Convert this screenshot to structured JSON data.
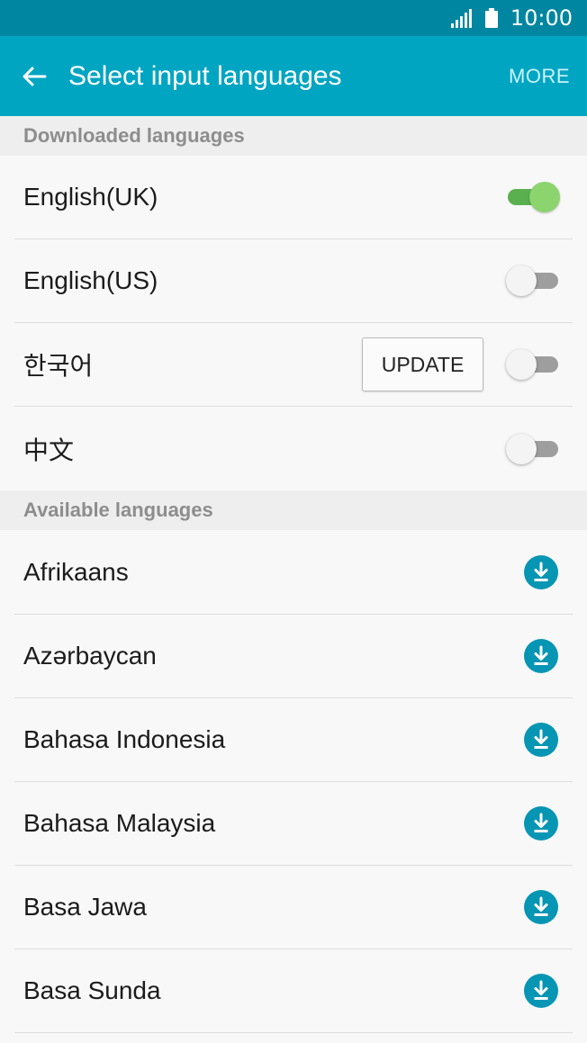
{
  "status_bar": {
    "time": "10:00"
  },
  "app_bar": {
    "title": "Select input languages",
    "more_label": "MORE"
  },
  "downloaded_section": {
    "header": "Downloaded languages",
    "items": [
      {
        "label": "English(UK)",
        "enabled": true
      },
      {
        "label": "English(US)",
        "enabled": false
      },
      {
        "label": "한국어",
        "enabled": false,
        "update_label": "UPDATE"
      },
      {
        "label": "中文",
        "enabled": false
      }
    ]
  },
  "available_section": {
    "header": "Available languages",
    "items": [
      {
        "label": "Afrikaans"
      },
      {
        "label": "Azərbaycan"
      },
      {
        "label": "Bahasa Indonesia"
      },
      {
        "label": "Bahasa Malaysia"
      },
      {
        "label": "Basa Jawa"
      },
      {
        "label": "Basa Sunda"
      }
    ]
  },
  "colors": {
    "status_bar": "#0086a0",
    "app_bar": "#00a5c2",
    "toggle_on": "#8bd46e",
    "download_icon": "#0795b4"
  }
}
